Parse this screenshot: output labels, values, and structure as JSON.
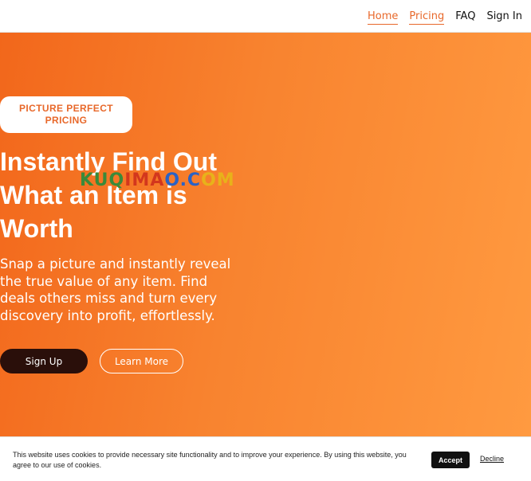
{
  "nav": {
    "items": [
      {
        "label": "Home",
        "active": true
      },
      {
        "label": "Pricing",
        "active": true
      },
      {
        "label": "FAQ",
        "active": false
      },
      {
        "label": "Sign In",
        "active": false
      }
    ]
  },
  "hero": {
    "badge": "PICTURE PERFECT PRICING",
    "headline": "Instantly Find Out What an Item is Worth",
    "subtext": "Snap a picture and instantly reveal the true value of any item. Find deals others miss and turn every discovery into profit, effortlessly.",
    "signup_label": "Sign Up",
    "learn_more_label": "Learn More",
    "watermark": [
      "KUQ",
      "IMA",
      "O.C",
      "OM"
    ]
  },
  "cookie": {
    "text": "This website uses cookies to provide necessary site functionality and to improve your experience. By using this website, you agree to our use of cookies.",
    "accept_label": "Accept",
    "decline_label": "Decline"
  },
  "colors": {
    "accent": "#e8682a",
    "hero_start": "#f2671b",
    "hero_end": "#ff9a40",
    "dark_button": "#2a0f0a"
  }
}
